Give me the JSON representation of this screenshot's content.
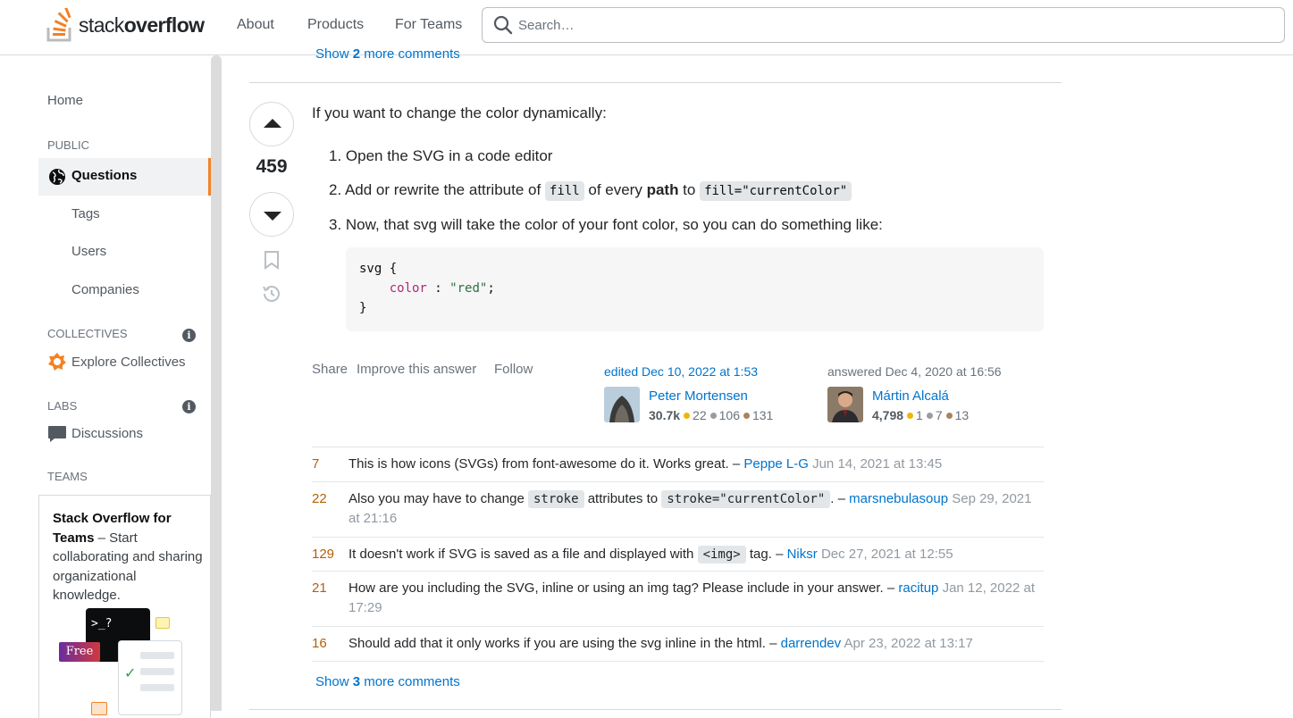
{
  "header": {
    "logo_light": "stack",
    "logo_bold": "overflow",
    "nav": [
      "About",
      "Products",
      "For Teams"
    ],
    "search_placeholder": "Search…"
  },
  "sidebar": {
    "home": "Home",
    "public_heading": "PUBLIC",
    "questions": "Questions",
    "tags": "Tags",
    "users": "Users",
    "companies": "Companies",
    "collectives_heading": "COLLECTIVES",
    "explore_collectives": "Explore Collectives",
    "labs_heading": "LABS",
    "discussions": "Discussions",
    "teams_heading": "TEAMS",
    "teams_title": "Stack Overflow for Teams",
    "teams_desc": " – Start collaborating and sharing organizational knowledge.",
    "free_badge": "Free",
    "terminal_prompt": ">_?"
  },
  "answer": {
    "prev_show": "Show",
    "prev_count": "2",
    "prev_more": "more comments",
    "score": "459",
    "intro": "If you want to change the color dynamically:",
    "steps": {
      "s1": "1. Open the SVG in a code editor",
      "s2_a": "2. Add or rewrite the attribute of ",
      "s2_code1": "fill",
      "s2_b": " of every ",
      "s2_bold": "path",
      "s2_c": " to ",
      "s2_code2": "fill=\"currentColor\"",
      "s3": "3. Now, that svg will take the color of your font color, so you can do something like:"
    },
    "code": {
      "l1": "svg {",
      "prop": "color",
      "colon": " : ",
      "val": "\"red\"",
      "semi": ";",
      "l3": "}"
    },
    "actions": [
      "Share",
      "Improve this answer",
      "Follow"
    ],
    "editor": {
      "label": "edited Dec 10, 2022 at 1:53",
      "name": "Peter Mortensen",
      "rep": "30.7k",
      "gold": "22",
      "silver": "106",
      "bronze": "131"
    },
    "author": {
      "label": "answered Dec 4, 2020 at 16:56",
      "name": "Mártin Alcalá",
      "rep": "4,798",
      "gold": "1",
      "silver": "7",
      "bronze": "13"
    },
    "badge_colors": {
      "gold": "#f1b600",
      "silver": "#9a9c9f",
      "bronze": "#ab825f"
    }
  },
  "comments": [
    {
      "score": "7",
      "text": "This is how icons (SVGs) from font-awesome do it. Works great. – ",
      "user": "Peppe L-G",
      "date": "Jun 14, 2021 at 13:45"
    },
    {
      "score": "22",
      "text_a": "Also you may have to change ",
      "code1": "stroke",
      "text_b": " attributes to ",
      "code2": "stroke=\"currentColor\"",
      "text_c": ". – ",
      "user": "marsnebulasoup",
      "date": "Sep 29, 2021 at 21:16"
    },
    {
      "score": "129",
      "text_a": "It doesn't work if SVG is saved as a file and displayed with ",
      "code1": "<img>",
      "text_b": " tag. – ",
      "user": "Niksr",
      "date": "Dec 27, 2021 at 12:55"
    },
    {
      "score": "21",
      "text": "How are you including the SVG, inline or using an img tag? Please include in your answer. – ",
      "user": "racitup",
      "date": "Jan 12, 2022 at 17:29"
    },
    {
      "score": "16",
      "text": "Should add that it only works if you are using the svg inline in the html. – ",
      "user": "darrendev",
      "date": "Apr 23, 2022 at 13:17"
    }
  ],
  "show_more": {
    "show": "Show",
    "count": "3",
    "more": "more comments"
  }
}
